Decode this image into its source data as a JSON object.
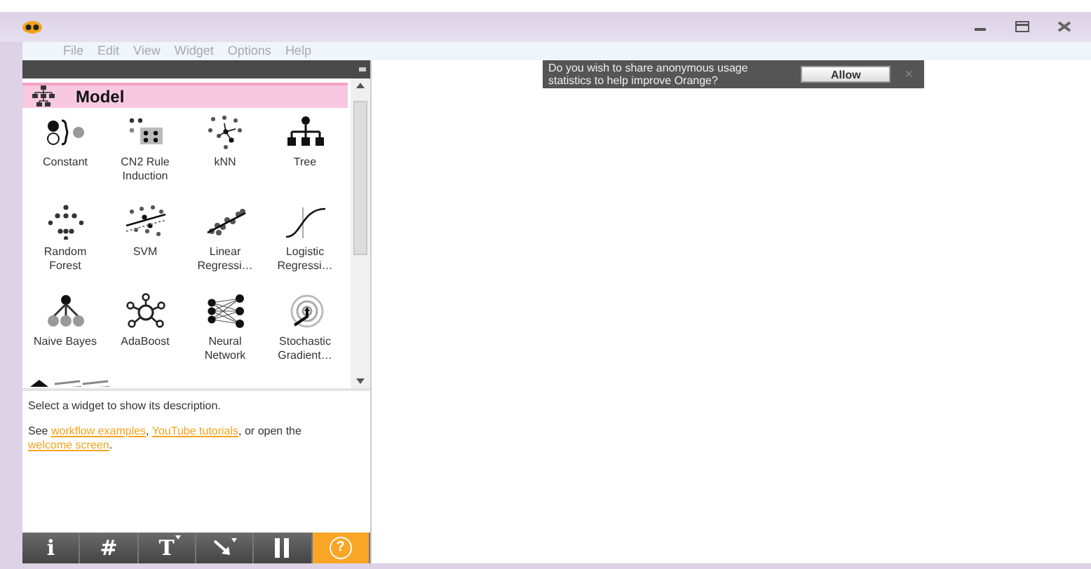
{
  "menu": [
    {
      "label": "File"
    },
    {
      "label": "Edit"
    },
    {
      "label": "View"
    },
    {
      "label": "Widget"
    },
    {
      "label": "Options"
    },
    {
      "label": "Help"
    }
  ],
  "toolbox": {
    "category": "Model",
    "widgets": [
      {
        "label": "Constant",
        "kind": "constant"
      },
      {
        "label": "CN2 Rule Induction",
        "kind": "cn2"
      },
      {
        "label": "kNN",
        "kind": "knn"
      },
      {
        "label": "Tree",
        "kind": "tree"
      },
      {
        "label": "Random Forest",
        "kind": "forest"
      },
      {
        "label": "SVM",
        "kind": "svm"
      },
      {
        "label": "Linear Regressi…",
        "kind": "linear"
      },
      {
        "label": "Logistic Regressi…",
        "kind": "logistic"
      },
      {
        "label": "Naive Bayes",
        "kind": "bayes"
      },
      {
        "label": "AdaBoost",
        "kind": "ada"
      },
      {
        "label": "Neural Network",
        "kind": "neural"
      },
      {
        "label": "Stochastic Gradient…",
        "kind": "sgd"
      }
    ],
    "partial_widgets": [
      {
        "kind": "mound"
      },
      {
        "kind": "stripes"
      },
      {
        "kind": "stripes"
      }
    ]
  },
  "description": {
    "text": "Select a widget to show its description.",
    "parts": [
      {
        "text": "See ",
        "link": false
      },
      {
        "text": "workflow examples",
        "link": true
      },
      {
        "text": ", ",
        "link": false
      },
      {
        "text": "YouTube tutorials",
        "link": true
      },
      {
        "text": ", or open the ",
        "link": false
      },
      {
        "text": "welcome screen",
        "link": true
      },
      {
        "text": ".",
        "link": false
      }
    ]
  },
  "toolbar": [
    {
      "kind": "text",
      "glyph": "i",
      "checked": false
    },
    {
      "kind": "text",
      "glyph": "#",
      "checked": false
    },
    {
      "kind": "text-menu",
      "glyph": "T",
      "checked": false
    },
    {
      "kind": "arrow",
      "checked": false
    },
    {
      "kind": "pause",
      "checked": false
    },
    {
      "kind": "help",
      "glyph": "?",
      "checked": true
    }
  ],
  "notification": {
    "text": "Do you wish to share anonymous usage statistics to help improve Orange?",
    "button": "Allow",
    "close": "×"
  }
}
